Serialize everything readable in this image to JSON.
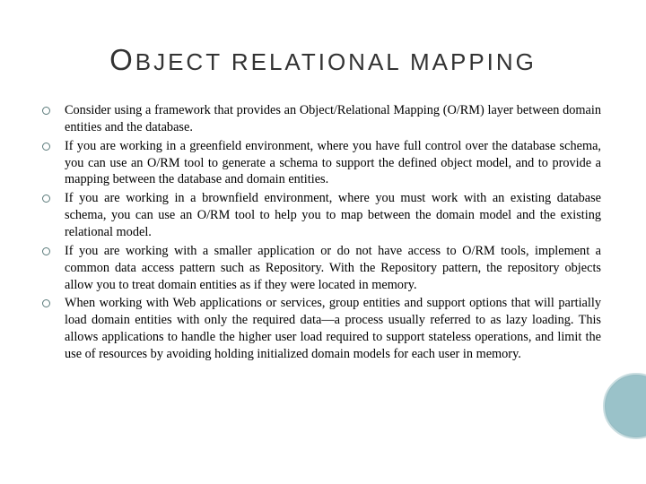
{
  "title_cap": "O",
  "title_rest": "BJECT RELATIONAL MAPPING",
  "bullets": [
    "Consider using a framework that provides an Object/Relational Mapping (O/RM) layer between domain entities and the database.",
    "If you are working in a greenfield environment, where you have full control over the database schema, you can use an O/RM tool to generate a schema to support the defined object model, and to provide a mapping between the database and domain entities.",
    "If you are working in a brownfield environment, where you must work with an existing database schema, you can use an O/RM tool to help you to map between the domain model and the existing relational model.",
    "If you are working with a smaller application or do not have access to O/RM tools, implement a common data access pattern such as Repository. With the Repository pattern, the repository objects allow you to treat domain entities as if they were located in memory.",
    "When working with Web applications or services, group entities and support options that will partially load domain entities with only the required data—a process usually referred to as lazy loading. This allows applications to handle the higher user load required to support stateless operations, and limit the use of resources by avoiding holding initialized domain models for each user in memory."
  ],
  "accent_color": "#9ac2c9"
}
